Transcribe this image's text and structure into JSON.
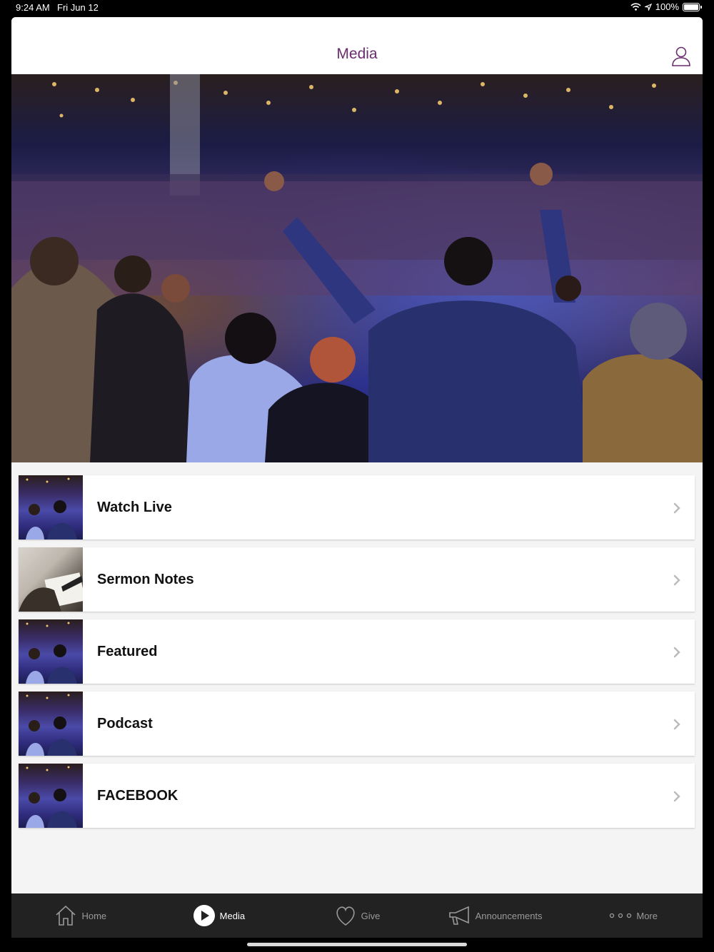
{
  "status_bar": {
    "time": "9:24 AM",
    "date": "Fri Jun 12",
    "battery": "100%"
  },
  "header": {
    "title": "Media"
  },
  "hero": {
    "icon": "hero-photo-worship-crowd"
  },
  "media_list": [
    {
      "label": "Watch Live",
      "thumbnail": "crowd"
    },
    {
      "label": "Sermon Notes",
      "thumbnail": "notes"
    },
    {
      "label": "Featured",
      "thumbnail": "crowd"
    },
    {
      "label": "Podcast",
      "thumbnail": "crowd"
    },
    {
      "label": "FACEBOOK",
      "thumbnail": "crowd"
    }
  ],
  "tabbar": {
    "items": [
      {
        "label": "Home",
        "icon": "home-icon",
        "active": false
      },
      {
        "label": "Media",
        "icon": "play-icon",
        "active": true
      },
      {
        "label": "Give",
        "icon": "heart-icon",
        "active": false
      },
      {
        "label": "Announcements",
        "icon": "megaphone-icon",
        "active": false
      },
      {
        "label": "More",
        "icon": "more-dots-icon",
        "active": false
      }
    ]
  },
  "colors": {
    "title": "#6a2c6e",
    "tabbar_bg": "#222222",
    "list_bg": "#f4f4f4"
  }
}
